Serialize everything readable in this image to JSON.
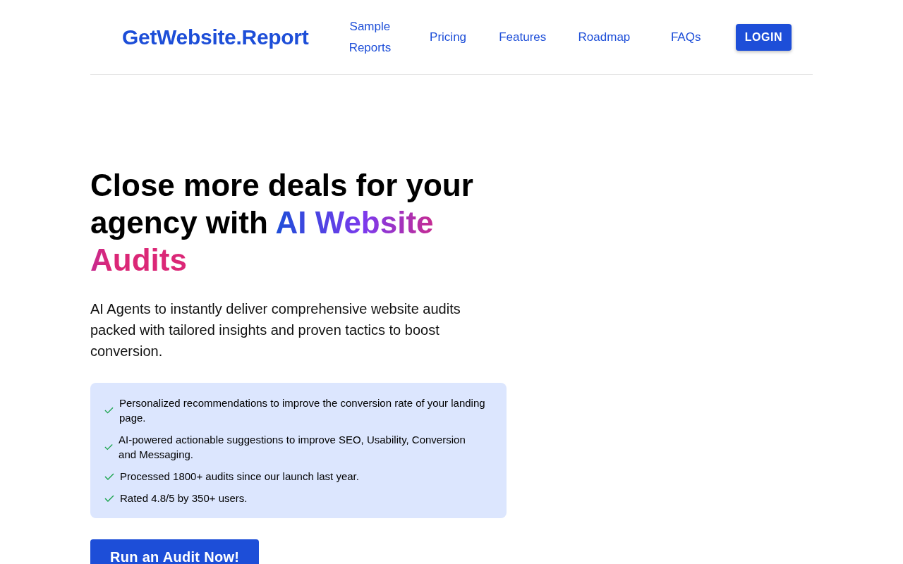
{
  "header": {
    "logo": "GetWebsite.Report",
    "nav": [
      {
        "label": "Sample Reports"
      },
      {
        "label": "Pricing"
      },
      {
        "label": "Features"
      },
      {
        "label": "Roadmap"
      },
      {
        "label": "FAQs"
      }
    ],
    "login": "LOGIN"
  },
  "hero": {
    "headline": "Close more deals for your agency with ",
    "headline_highlight": "AI Website Audits",
    "subtitle": "AI Agents to instantly deliver comprehensive website audits packed with tailored insights and proven tactics to boost conversion.",
    "benefits": [
      {
        "text": "Personalized recommendations to improve the conversion rate of your landing page."
      },
      {
        "text": "AI-powered actionable suggestions to improve SEO, Usability, Conversion and Messaging."
      },
      {
        "text": "Processed 1800+ audits since our launch last year."
      },
      {
        "text": "Rated 4.8/5 by 350+ users."
      }
    ],
    "cta": "Run an Audit Now!"
  }
}
